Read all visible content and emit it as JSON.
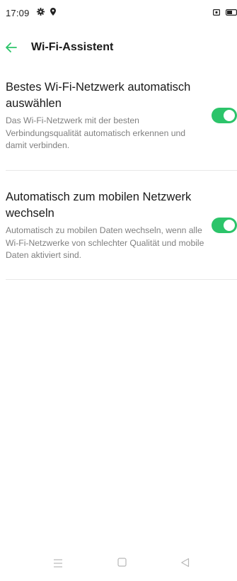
{
  "status_bar": {
    "time": "17:09",
    "icons": [
      "gear-icon",
      "location-pin-icon",
      "screen-record-icon",
      "battery-icon"
    ]
  },
  "header": {
    "title": "Wi-Fi-Assistent",
    "back_icon": "back-arrow-icon",
    "accent_color": "#2cc46a"
  },
  "settings": [
    {
      "title": "Bestes Wi-Fi-Netzwerk automatisch auswählen",
      "description": "Das Wi-Fi-Netzwerk mit der besten Verbindungsqualität automatisch erkennen und damit verbinden.",
      "enabled": true
    },
    {
      "title": "Automatisch zum mobilen Netzwerk wechseln",
      "description": "Automatisch zu mobilen Daten wechseln, wenn alle Wi-Fi-Netzwerke von schlechter Qualität und mobile Daten aktiviert sind.",
      "enabled": true
    }
  ],
  "nav_bar": {
    "icons": [
      "menu-icon",
      "home-icon",
      "back-icon"
    ]
  }
}
